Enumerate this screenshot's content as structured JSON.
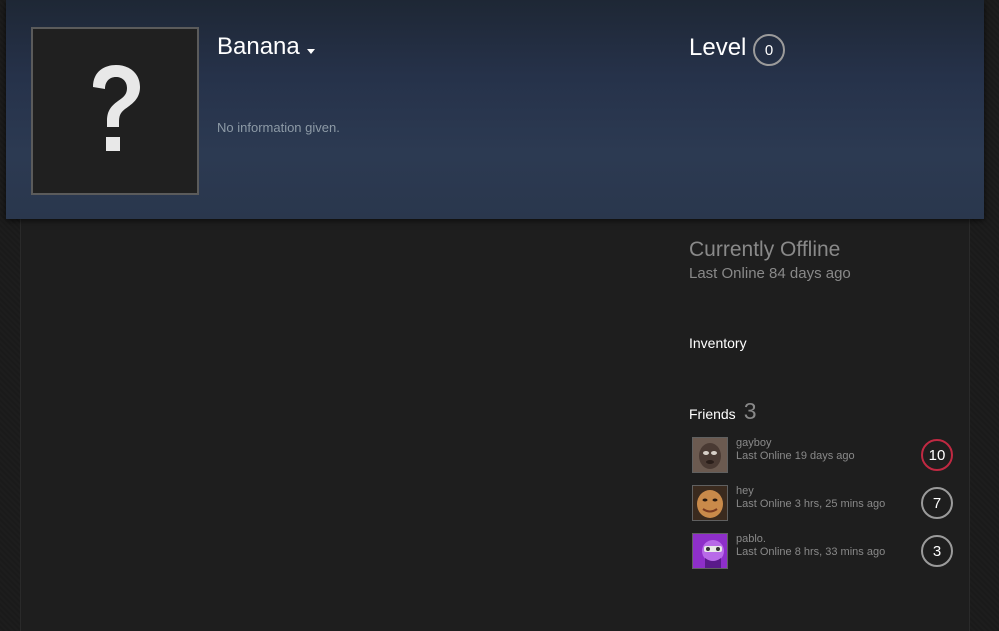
{
  "profile": {
    "persona_name": "Banana",
    "summary": "No information given.",
    "level_label": "Level",
    "level_value": "0",
    "avatar_icon": "question-mark-icon"
  },
  "status": {
    "title": "Currently Offline",
    "last_online": "Last Online 84 days ago"
  },
  "links": {
    "inventory": "Inventory"
  },
  "friends": {
    "label": "Friends",
    "count": "3",
    "items": [
      {
        "name": "gayboy",
        "status": "Last Online 19 days ago",
        "level": "10",
        "level_color": "#c02942"
      },
      {
        "name": "hey",
        "status": "Last Online 3 hrs, 25 mins ago",
        "level": "7",
        "level_color": "#9b9b9b"
      },
      {
        "name": "pablo.",
        "status": "Last Online 8 hrs, 33 mins ago",
        "level": "3",
        "level_color": "#9b9b9b"
      }
    ]
  },
  "colors": {
    "header_bg": "#2c3a52",
    "page_bg": "#1b1b1b",
    "muted_text": "#898989"
  }
}
